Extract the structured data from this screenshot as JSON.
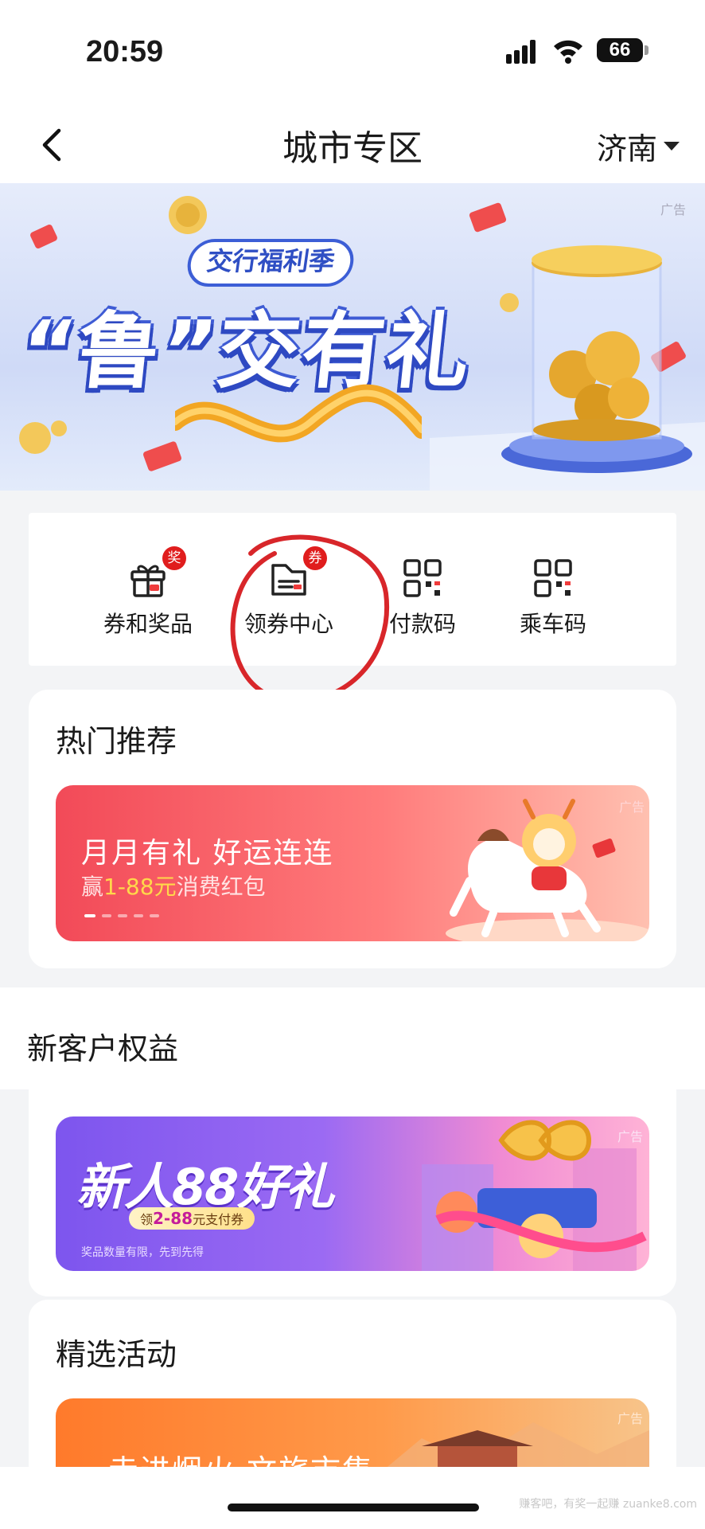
{
  "status_bar": {
    "time": "20:59",
    "battery": "66"
  },
  "nav": {
    "title": "城市专区",
    "city": "济南"
  },
  "banner": {
    "ad_label": "广告",
    "brand": "交行福利季",
    "title": "“鲁”交有礼"
  },
  "quick_actions": [
    {
      "label": "券和奖品",
      "icon": "gift-icon",
      "badge": "奖"
    },
    {
      "label": "领券中心",
      "icon": "coupon-icon",
      "badge": "券"
    },
    {
      "label": "付款码",
      "icon": "qr-code-icon",
      "badge": ""
    },
    {
      "label": "乘车码",
      "icon": "qr-code-icon",
      "badge": ""
    }
  ],
  "hot": {
    "title": "热门推荐",
    "promo": {
      "title": "月月有礼 好运连连",
      "sub_prefix": "赢",
      "sub_highlight": "1-88元",
      "sub_suffix": "消费红包",
      "ad_label": "广告"
    }
  },
  "new_customer": {
    "title": "新客户权益",
    "promo": {
      "title": "新人88好礼",
      "pill_prefix": "领",
      "pill_highlight": "2-88",
      "pill_suffix": "元支付券",
      "note": "奖品数量有限，先到先得",
      "ad_label": "广告"
    }
  },
  "selected": {
    "title": "精选活动",
    "promo": {
      "title": "走进烟火 文旅市集",
      "ad_label": "广告"
    }
  },
  "watermark": "赚客吧，有奖一起赚 zuanke8.com",
  "colors": {
    "accent_red": "#e01d1d",
    "brand_blue": "#2f4fc4"
  }
}
